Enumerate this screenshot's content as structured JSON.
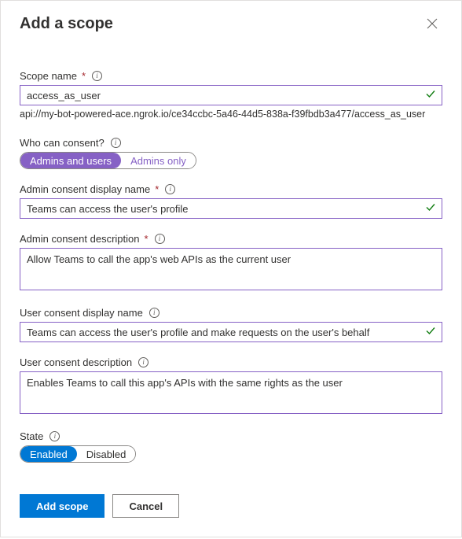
{
  "header": {
    "title": "Add a scope"
  },
  "scope_name": {
    "label": "Scope name",
    "value": "access_as_user",
    "uri": "api://my-bot-powered-ace.ngrok.io/ce34ccbc-5a46-44d5-838a-f39fbdb3a477/access_as_user"
  },
  "who_consent": {
    "label": "Who can consent?",
    "options": [
      "Admins and users",
      "Admins only"
    ],
    "selected": "Admins and users"
  },
  "admin_display": {
    "label": "Admin consent display name",
    "value": "Teams can access the user's profile"
  },
  "admin_desc": {
    "label": "Admin consent description",
    "value": "Allow Teams to call the app's web APIs as the current user"
  },
  "user_display": {
    "label": "User consent display name",
    "value": "Teams can access the user's profile and make requests on the user's behalf"
  },
  "user_desc": {
    "label": "User consent description",
    "value": "Enables Teams to call this app's APIs with the same rights as the user"
  },
  "state": {
    "label": "State",
    "options": [
      "Enabled",
      "Disabled"
    ],
    "selected": "Enabled"
  },
  "footer": {
    "primary": "Add scope",
    "secondary": "Cancel"
  }
}
